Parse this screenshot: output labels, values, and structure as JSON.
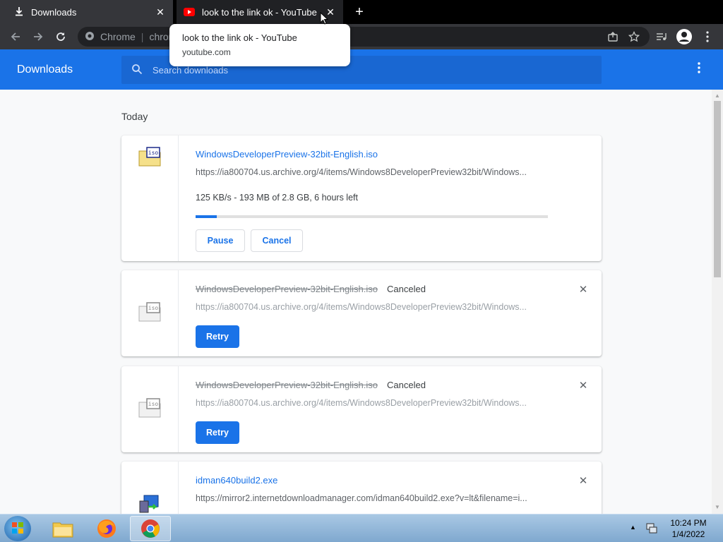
{
  "tabs": [
    {
      "title": "Downloads",
      "icon": "download-icon",
      "active": true
    },
    {
      "title": "look to the link ok - YouTube",
      "icon": "youtube-icon",
      "active": false
    }
  ],
  "omnibox": {
    "prefix": "Chrome",
    "text": "chrom"
  },
  "tooltip": {
    "title": "look to the link ok - YouTube",
    "url": "youtube.com"
  },
  "header": {
    "title": "Downloads",
    "search_placeholder": "Search downloads"
  },
  "section_date": "Today",
  "downloads": [
    {
      "filename": "WindowsDeveloperPreview-32bit-English.iso",
      "url": "https://ia800704.us.archive.org/4/items/Windows8DeveloperPreview32bit/Windows...",
      "progress_text": "125 KB/s - 193 MB of 2.8 GB, 6 hours left",
      "progress_fraction": 0.06,
      "buttons": [
        "Pause",
        "Cancel"
      ]
    },
    {
      "filename": "WindowsDeveloperPreview-32bit-English.iso",
      "status": "Canceled",
      "url": "https://ia800704.us.archive.org/4/items/Windows8DeveloperPreview32bit/Windows...",
      "button": "Retry"
    },
    {
      "filename": "WindowsDeveloperPreview-32bit-English.iso",
      "status": "Canceled",
      "url": "https://ia800704.us.archive.org/4/items/Windows8DeveloperPreview32bit/Windows...",
      "button": "Retry"
    },
    {
      "filename": "idman640build2.exe",
      "url": "https://mirror2.internetdownloadmanager.com/idman640build2.exe?v=lt&filename=i..."
    }
  ],
  "taskbar": {
    "time": "10:24 PM",
    "date": "1/4/2022"
  },
  "colors": {
    "accent": "#1a73e8",
    "header_bg": "#1a73e8",
    "tab_bg": "#35363a"
  }
}
